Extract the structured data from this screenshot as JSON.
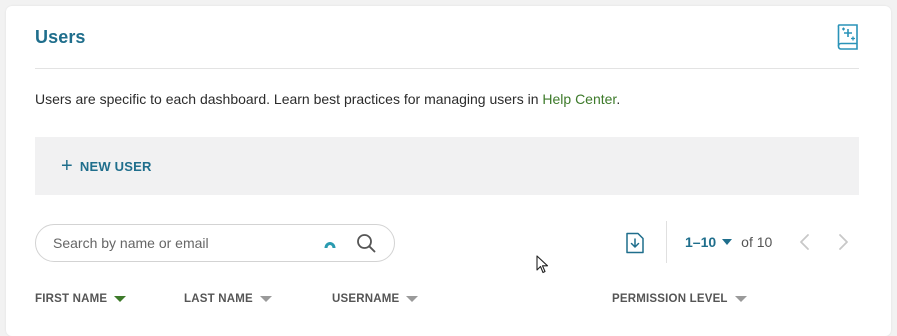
{
  "panel": {
    "title": "Users",
    "description_text": "Users are specific to each dashboard. Learn best practices for managing users in ",
    "help_link": "Help Center",
    "description_end": "."
  },
  "toolbar": {
    "new_user_label": "NEW USER",
    "plus_symbol": "+"
  },
  "search": {
    "placeholder": "Search by name or email",
    "value": ""
  },
  "pagination": {
    "range": "1–10",
    "of_label": "of 10"
  },
  "table": {
    "columns": [
      "FIRST NAME",
      "LAST NAME",
      "USERNAME",
      "PERMISSION LEVEL"
    ],
    "sorted_column": "FIRST NAME"
  },
  "colors": {
    "accent": "#1f6e8c",
    "link": "#3d7a2a",
    "action_bar": "#f1f1f2"
  },
  "icons": {
    "book": "book-sparkle-icon",
    "search": "search-icon",
    "assist": "assist-icon",
    "export": "download-file-icon",
    "prev": "chevron-left-icon",
    "next": "chevron-right-icon"
  }
}
